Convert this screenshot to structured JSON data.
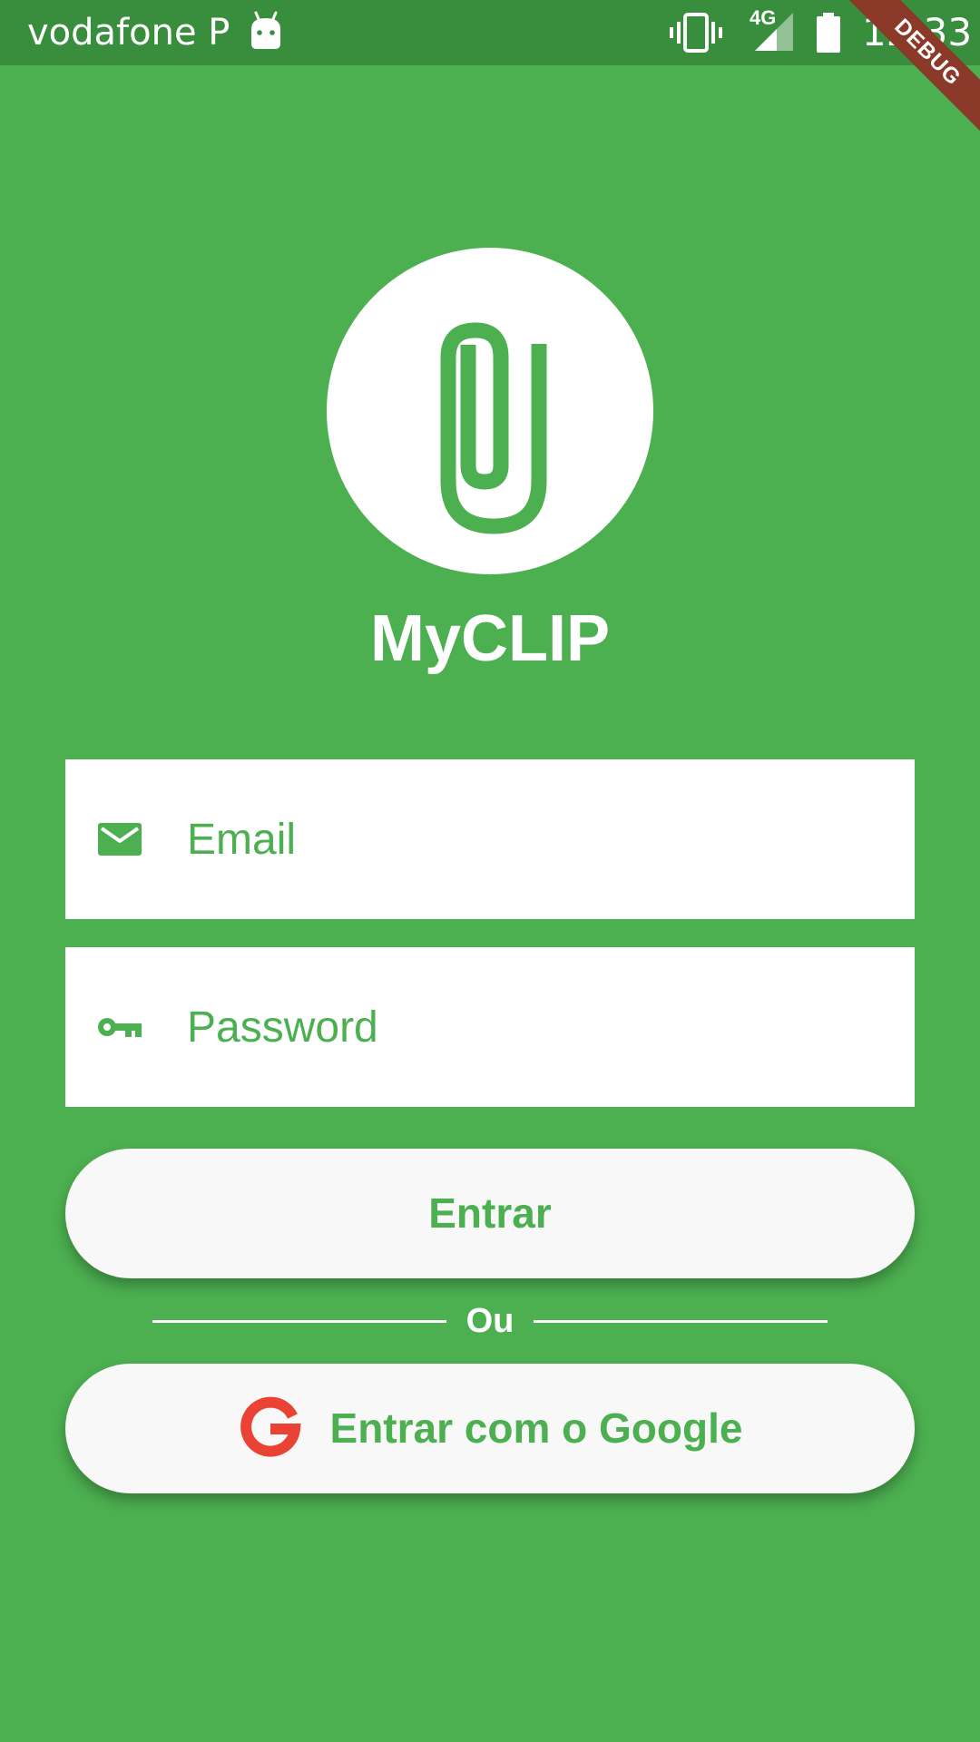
{
  "status_bar": {
    "carrier": "vodafone P",
    "network_type": "4G",
    "time": "12:33",
    "icons": [
      "android-icon",
      "vibrate-icon",
      "signal-icon",
      "battery-icon"
    ]
  },
  "debug_banner": "DEBUG",
  "app": {
    "title": "MyCLIP",
    "logo_icon": "paperclip-icon"
  },
  "form": {
    "email_placeholder": "Email",
    "email_value": "",
    "email_icon": "mail-icon",
    "password_placeholder": "Password",
    "password_value": "",
    "password_icon": "key-icon"
  },
  "buttons": {
    "login_label": "Entrar",
    "divider_label": "Ou",
    "google_label": "Entrar com o Google",
    "google_icon": "google-icon"
  },
  "colors": {
    "primary": "#4CAF50",
    "status_bar": "#388E3C",
    "button_bg": "#F8F8F8",
    "google_red": "#EA4335",
    "debug_banner": "#8B3A2A"
  }
}
